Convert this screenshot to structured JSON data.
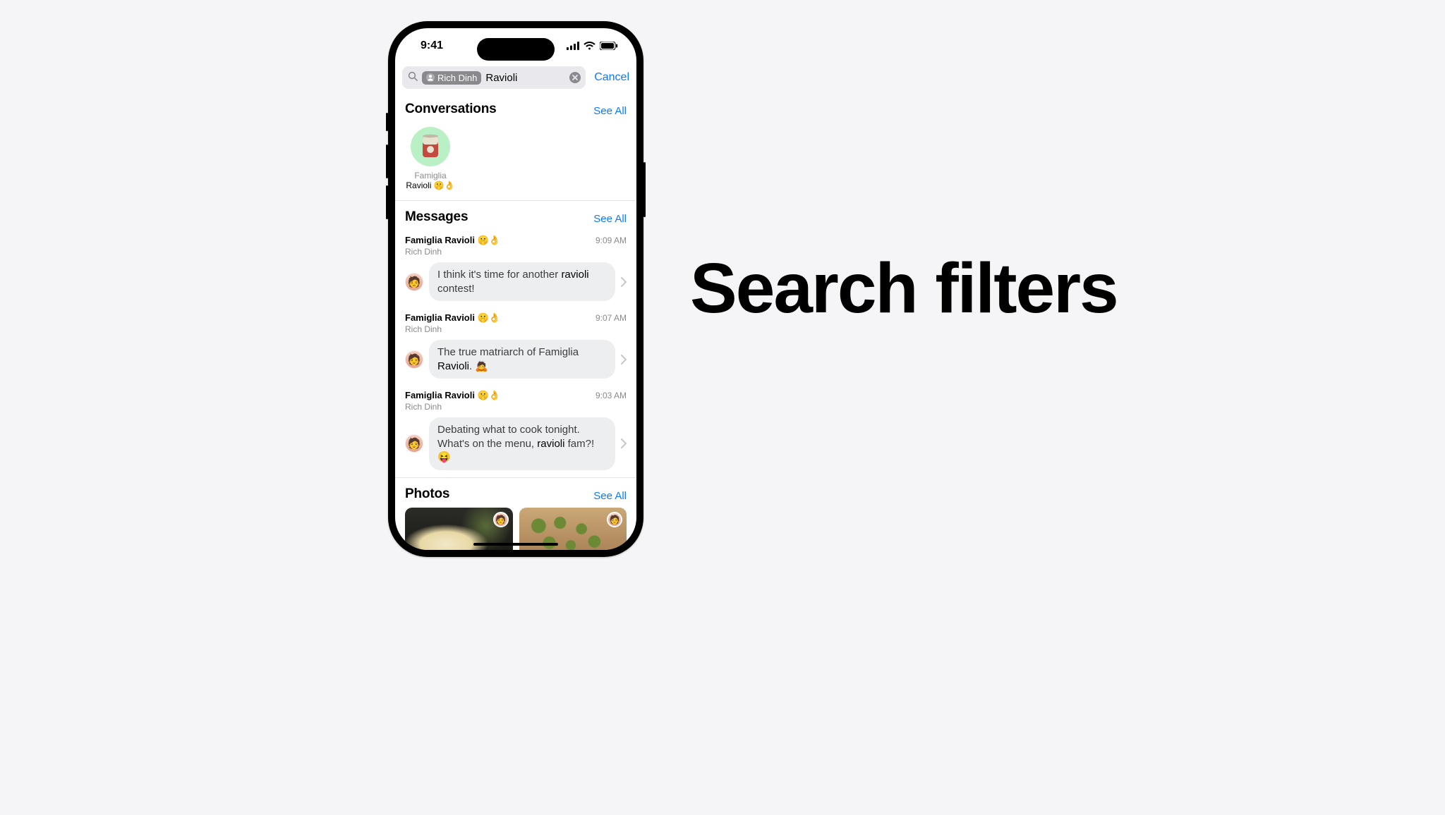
{
  "feature_title": "Search filters",
  "status": {
    "time": "9:41"
  },
  "search": {
    "chip_label": "Rich Dinh",
    "query": "Ravioli",
    "cancel": "Cancel"
  },
  "sections": {
    "conversations": {
      "title": "Conversations",
      "see_all": "See All"
    },
    "messages": {
      "title": "Messages",
      "see_all": "See All"
    },
    "photos": {
      "title": "Photos",
      "see_all": "See All"
    }
  },
  "conversation": {
    "name": "Famiglia",
    "subtitle": "Ravioli 🤫👌"
  },
  "messages": [
    {
      "thread": "Famiglia Ravioli 🤫👌",
      "sender": "Rich Dinh",
      "time": "9:09 AM",
      "pre": "I think it's time for another ",
      "hit": "ravioli",
      "post": " contest!"
    },
    {
      "thread": "Famiglia Ravioli 🤫👌",
      "sender": "Rich Dinh",
      "time": "9:07 AM",
      "pre": "The true matriarch of Famiglia ",
      "hit": "Ravioli",
      "post": ". 🙇"
    },
    {
      "thread": "Famiglia Ravioli 🤫👌",
      "sender": "Rich Dinh",
      "time": "9:03 AM",
      "pre": "Debating what to cook tonight. What's on the menu, ",
      "hit": "ravioli",
      "post": " fam?! 😝"
    }
  ]
}
